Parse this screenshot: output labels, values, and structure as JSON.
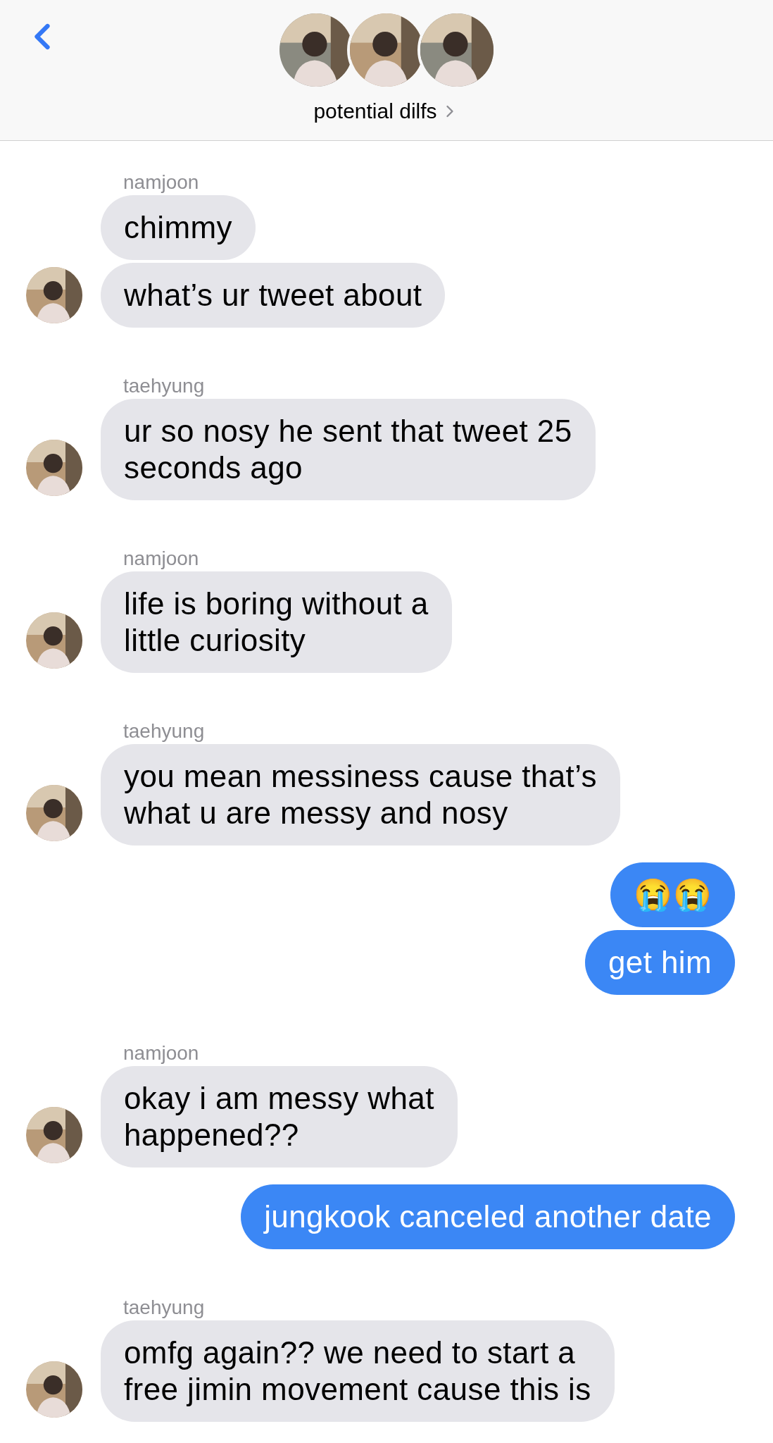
{
  "header": {
    "title": "potential dilfs"
  },
  "groups": [
    {
      "kind": "received",
      "sender": "namjoon",
      "messages": [
        "chimmy",
        "what’s ur tweet about"
      ]
    },
    {
      "kind": "received",
      "sender": "taehyung",
      "messages": [
        "ur so nosy he sent that tweet 25\nseconds ago"
      ]
    },
    {
      "kind": "received",
      "sender": "namjoon",
      "messages": [
        "life is boring without a\nlittle curiosity"
      ]
    },
    {
      "kind": "received",
      "sender": "taehyung",
      "messages": [
        "you mean messiness cause that’s\nwhat u are messy and nosy"
      ]
    },
    {
      "kind": "sent",
      "messages": [
        "😭😭",
        "get him"
      ]
    },
    {
      "kind": "received",
      "sender": "namjoon",
      "messages": [
        "okay i am messy what\nhappened??"
      ]
    },
    {
      "kind": "sent",
      "messages": [
        "jungkook canceled another date"
      ]
    },
    {
      "kind": "received",
      "sender": "taehyung",
      "messages": [
        "omfg again?? we need to start a\nfree jimin movement cause this is"
      ]
    }
  ]
}
